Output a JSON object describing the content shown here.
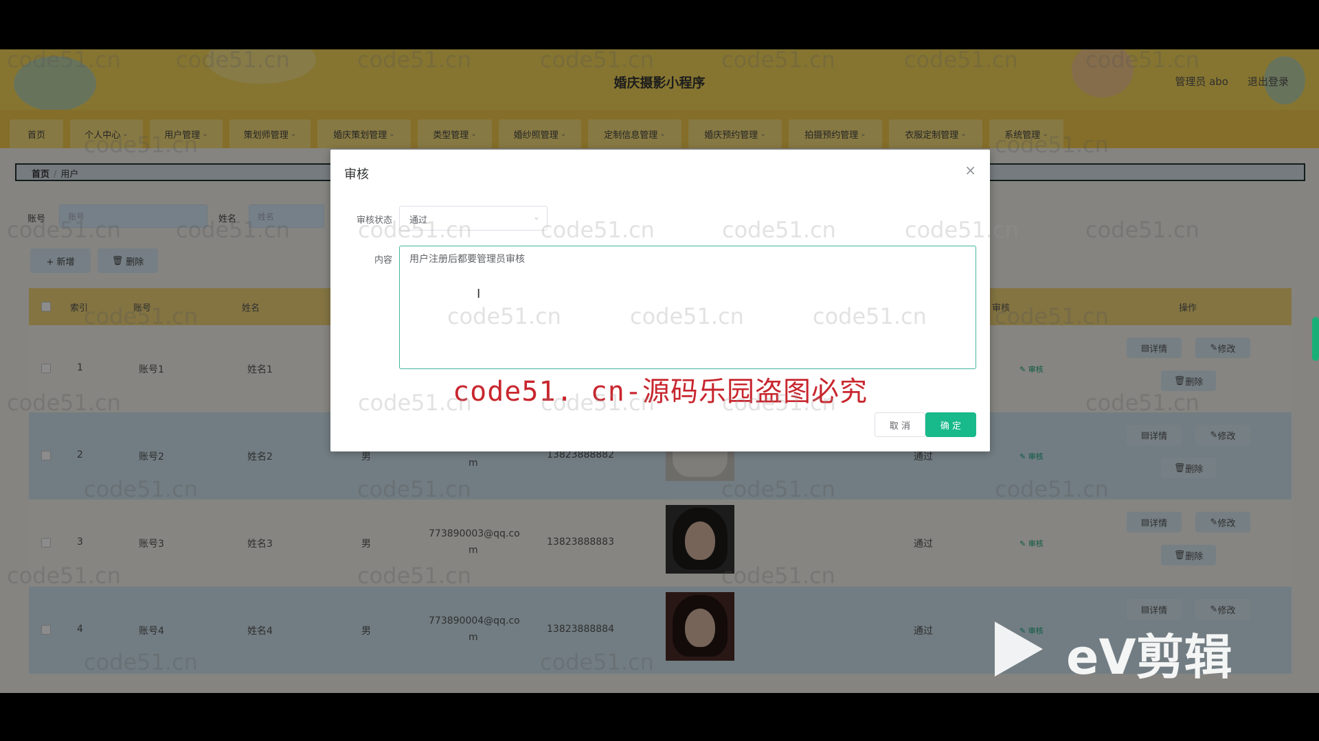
{
  "header": {
    "title": "婚庆摄影小程序",
    "admin_label": "管理员 abo",
    "logout_label": "退出登录"
  },
  "nav": {
    "items": [
      {
        "label": "首页"
      },
      {
        "label": "个人中心"
      },
      {
        "label": "用户管理"
      },
      {
        "label": "策划师管理"
      },
      {
        "label": "婚庆策划管理"
      },
      {
        "label": "类型管理"
      },
      {
        "label": "婚纱照管理"
      },
      {
        "label": "定制信息管理"
      },
      {
        "label": "婚庆预约管理"
      },
      {
        "label": "拍摄预约管理"
      },
      {
        "label": "衣服定制管理"
      },
      {
        "label": "系统管理"
      }
    ]
  },
  "breadcrumb": {
    "home": "首页",
    "current": "用户"
  },
  "search": {
    "account_label": "账号",
    "account_placeholder": "账号",
    "name_label": "姓名",
    "name_placeholder": "姓名"
  },
  "toolbar": {
    "add_label": "+ 新增",
    "delete_label": "删除"
  },
  "table": {
    "headers": {
      "index": "索引",
      "account": "账号",
      "name": "姓名",
      "audit": "审核",
      "action": "操作"
    },
    "rows": [
      {
        "index": "1",
        "account": "账号1",
        "name": "姓名1",
        "gender": "",
        "email": "",
        "email2": "",
        "phone": "",
        "status": ""
      },
      {
        "index": "2",
        "account": "账号2",
        "name": "姓名2",
        "gender": "男",
        "email": "",
        "email2": "m",
        "phone": "13823888882",
        "status": "通过"
      },
      {
        "index": "3",
        "account": "账号3",
        "name": "姓名3",
        "gender": "男",
        "email": "773890003@qq.co",
        "email2": "m",
        "phone": "13823888883",
        "status": "通过"
      },
      {
        "index": "4",
        "account": "账号4",
        "name": "姓名4",
        "gender": "男",
        "email": "773890004@qq.co",
        "email2": "m",
        "phone": "13823888884",
        "status": "通过"
      }
    ],
    "audit_link": "审核",
    "detail_label": "详情",
    "edit_label": "修改",
    "delete_label": "删除"
  },
  "dialog": {
    "title": "审核",
    "close_glyph": "×",
    "status_label": "审核状态",
    "status_value": "通过",
    "content_label": "内容",
    "content_value": "用户注册后都要管理员审核",
    "cancel_label": "取 消",
    "confirm_label": "确 定"
  },
  "watermark": {
    "text": "code51.cn",
    "banner": "code51. cn-源码乐园盗图必究"
  },
  "ev_logo": {
    "text": "eV剪辑"
  },
  "colors": {
    "accent": "#18b98b",
    "header": "#f4d65a",
    "nav": "#f2c94c",
    "banner": "#c8262e"
  }
}
